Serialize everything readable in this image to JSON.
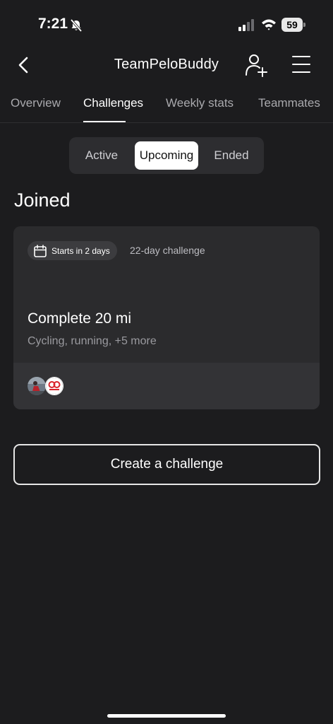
{
  "status": {
    "time": "7:21",
    "battery": "59"
  },
  "nav": {
    "title": "TeamPeloBuddy"
  },
  "tabs": [
    {
      "label": "Overview",
      "active": false
    },
    {
      "label": "Challenges",
      "active": true
    },
    {
      "label": "Weekly stats",
      "active": false
    },
    {
      "label": "Teammates",
      "active": false
    }
  ],
  "filter": {
    "options": [
      "Active",
      "Upcoming",
      "Ended"
    ],
    "selected": "Upcoming"
  },
  "section": {
    "title": "Joined"
  },
  "challenge": {
    "badge": "Starts in 2 days",
    "duration": "22-day challenge",
    "title": "Complete 20 mi",
    "activities": "Cycling, running, +5 more"
  },
  "create_button": "Create a challenge",
  "colors": {
    "background": "#1c1c1e",
    "card": "#2b2b2d",
    "accent_red": "#d9242b"
  }
}
